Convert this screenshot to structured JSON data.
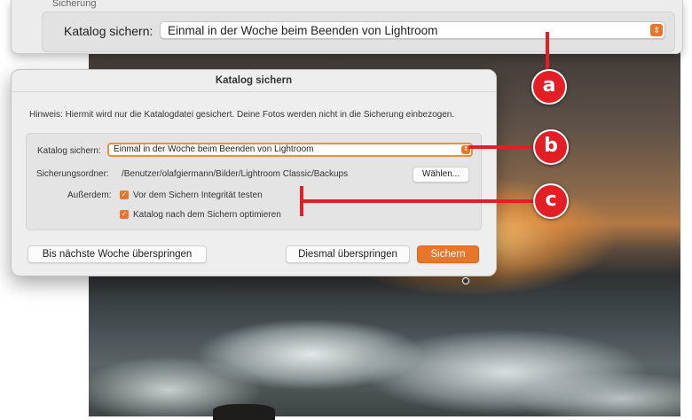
{
  "prefs": {
    "section_label": "Sicherung",
    "field_label": "Katalog sichern:",
    "selected_value": "Einmal in der Woche beim Beenden von Lightroom"
  },
  "dialog": {
    "title": "Katalog sichern",
    "hint": "Hinweis: Hiermit wird nur die Katalogdatei gesichert. Deine Fotos werden nicht in die Sicherung einbezogen.",
    "backup_label": "Katalog sichern:",
    "backup_value": "Einmal in der Woche beim Beenden von Lightroom",
    "folder_label": "Sicherungsordner:",
    "folder_path": "/Benutzer/olafgiermann/Bilder/Lightroom Classic/Backups",
    "choose_button": "Wählen...",
    "also_label": "Außerdem:",
    "checkbox_integrity": "Vor dem Sichern Integrität testen",
    "checkbox_integrity_checked": true,
    "checkbox_optimize": "Katalog nach dem Sichern optimieren",
    "checkbox_optimize_checked": true,
    "skip_week_button": "Bis nächste Woche überspringen",
    "skip_once_button": "Diesmal überspringen",
    "backup_button": "Sichern"
  },
  "callouts": [
    "a",
    "b",
    "c"
  ],
  "colors": {
    "accent": "#e8762a",
    "callout": "#e31e24"
  }
}
